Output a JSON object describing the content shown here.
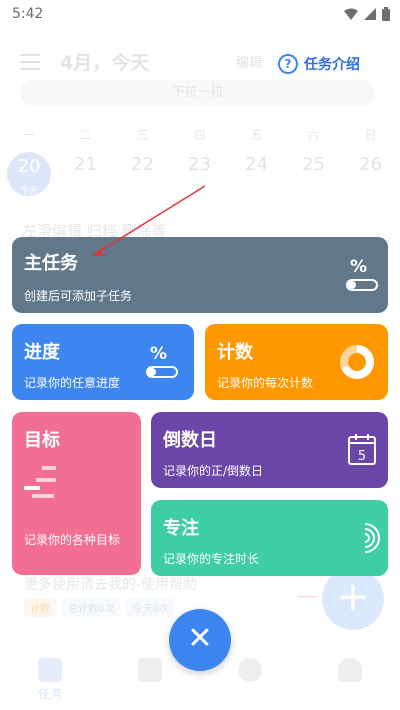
{
  "status_bar": {
    "time": "5:42",
    "wifi_icon": "wifi-icon",
    "signal_icon": "signal-icon",
    "battery_icon": "battery-icon"
  },
  "background": {
    "header_date": "4月，今天",
    "header_edit": "编辑",
    "pull_hint": "下拉一拉",
    "weekdays": [
      "一",
      "二",
      "三",
      "四",
      "五",
      "六",
      "日"
    ],
    "days": [
      "20",
      "21",
      "22",
      "23",
      "24",
      "25",
      "26"
    ],
    "today_label": "今天",
    "tip_line": "左滑编辑 归档 删除等",
    "help_line": "更多使用请去我的-使用帮助",
    "tags": [
      "计数",
      "总计数0次",
      "今天0次"
    ],
    "nav_items": [
      "任务",
      "",
      "",
      ""
    ]
  },
  "intro": {
    "icon": "question-circle-icon",
    "label": "任务介绍"
  },
  "cards": {
    "main_task": {
      "title": "主任务",
      "desc": "创建后可添加子任务",
      "icon": "percent-toggle-icon",
      "color": "#60788a"
    },
    "progress": {
      "title": "进度",
      "desc": "记录你的任意进度",
      "icon": "percent-toggle-icon",
      "color": "#3d86ef"
    },
    "count": {
      "title": "计数",
      "desc": "记录你的每次计数",
      "icon": "donut-counter-icon",
      "color": "#ff9800"
    },
    "goal": {
      "title": "目标",
      "desc": "记录你的各种目标",
      "icon": "bar-steps-icon",
      "color": "#f26e95"
    },
    "countdown": {
      "title": "倒数日",
      "desc": "记录你的正/倒数日",
      "icon": "calendar-5-icon",
      "calendar_number": "5",
      "color": "#6a46a8"
    },
    "focus": {
      "title": "专注",
      "desc": "记录你的专注时长",
      "icon": "focus-rings-icon",
      "color": "#3fcda4"
    }
  },
  "close_button": {
    "icon": "close-icon",
    "symbol": "✕"
  },
  "colors": {
    "accent": "#3d86ef",
    "arrow": "#d9363e"
  }
}
